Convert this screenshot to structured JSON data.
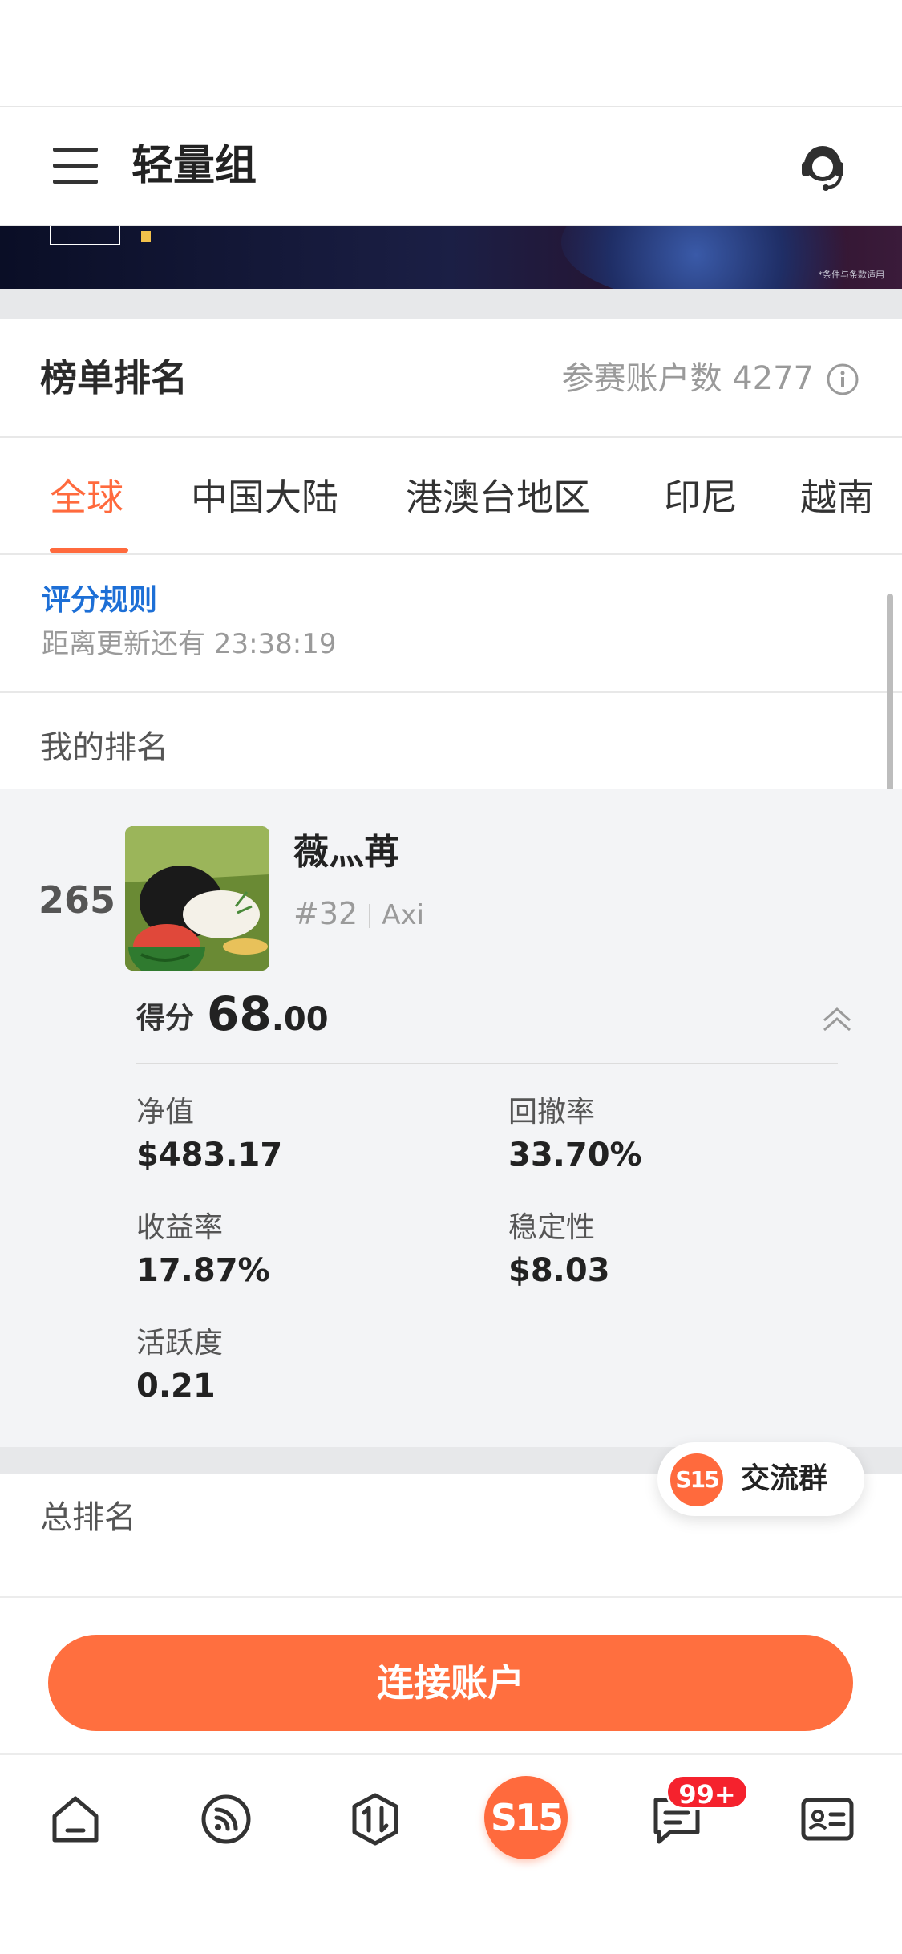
{
  "header": {
    "title": "轻量组"
  },
  "banner": {
    "note": "*条件与条款适用"
  },
  "leaderboard": {
    "title": "榜单排名",
    "participants_label": "参赛账户数",
    "participants_count": "4277"
  },
  "tabs": [
    {
      "label": "全球",
      "active": true
    },
    {
      "label": "中国大陆",
      "active": false
    },
    {
      "label": "港澳台地区",
      "active": false
    },
    {
      "label": "印尼",
      "active": false
    },
    {
      "label": "越南",
      "active": false
    }
  ],
  "rules": {
    "link_label": "评分规则",
    "countdown_text": "距离更新还有 23:38:19"
  },
  "my_rank": {
    "section_label": "我的排名",
    "rank": "265",
    "user_name": "薇灬苒",
    "user_number": "#32",
    "server": "Axi",
    "score_label": "得分",
    "score_int": "68",
    "score_dec": ".00",
    "stats": {
      "net_value_label": "净值",
      "net_value": "$483.17",
      "drawdown_label": "回撤率",
      "drawdown": "33.70%",
      "return_label": "收益率",
      "return": "17.87%",
      "stability_label": "稳定性",
      "stability": "$8.03",
      "activity_label": "活跃度",
      "activity": "0.21"
    }
  },
  "total_rank": {
    "label": "总排名"
  },
  "floating_group": {
    "badge": "S15",
    "label": "交流群"
  },
  "actions": {
    "connect_label": "连接账户"
  },
  "tabbar": {
    "center_badge": "S15",
    "messages_badge": "99+",
    "items": [
      "home-icon",
      "feed-icon",
      "trade-icon",
      "s15-icon",
      "messages-icon",
      "profile-card-icon"
    ]
  },
  "colors": {
    "accent": "#ff6a3d",
    "link": "#1d6fd6",
    "badge_red": "#f5222d"
  }
}
